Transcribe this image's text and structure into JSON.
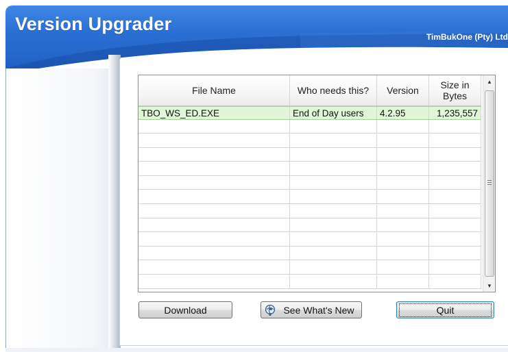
{
  "window": {
    "title": "Version Upgrader",
    "company": "TimBukOne (Pty) Ltd"
  },
  "grid": {
    "columns": [
      {
        "label": "File Name"
      },
      {
        "label": "Who needs this?"
      },
      {
        "label": "Version"
      },
      {
        "label": "Size in Bytes"
      }
    ],
    "rows": [
      {
        "file_name": "TBO_WS_ED.EXE",
        "who_needs": "End of Day users",
        "version": "4.2.95",
        "size": "1,235,557",
        "selected": true
      }
    ],
    "empty_row_count": 12
  },
  "buttons": {
    "download": "Download",
    "see_whats_new": "See What's New",
    "quit": "Quit"
  },
  "icons": {
    "whats_new_icon": "magnifier-globe-icon",
    "scroll_up": "scroll-up-arrow-icon",
    "scroll_down": "scroll-down-arrow-icon"
  },
  "colors": {
    "header_blue": "#2a6fd4",
    "selected_row": "#e0f7d7"
  }
}
